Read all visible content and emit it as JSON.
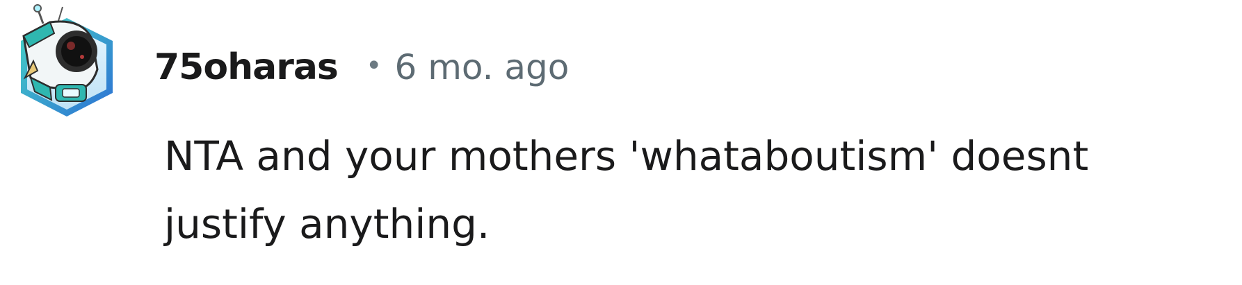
{
  "comment": {
    "username": "75oharas",
    "separator": "•",
    "timestamp": "6 mo. ago",
    "body": "NTA and your mothers 'whataboutism' doesnt justify anything."
  },
  "avatar": {
    "icon": "robot-snoo-avatar-icon",
    "colors": {
      "hex_gradient_top": "#3fd0c4",
      "hex_gradient_bottom": "#2a76d6",
      "helmet": "#2fb7b0",
      "visor": "#111111"
    }
  },
  "colors": {
    "text_primary": "#1a1a1b",
    "text_secondary": "#5d6b73"
  }
}
